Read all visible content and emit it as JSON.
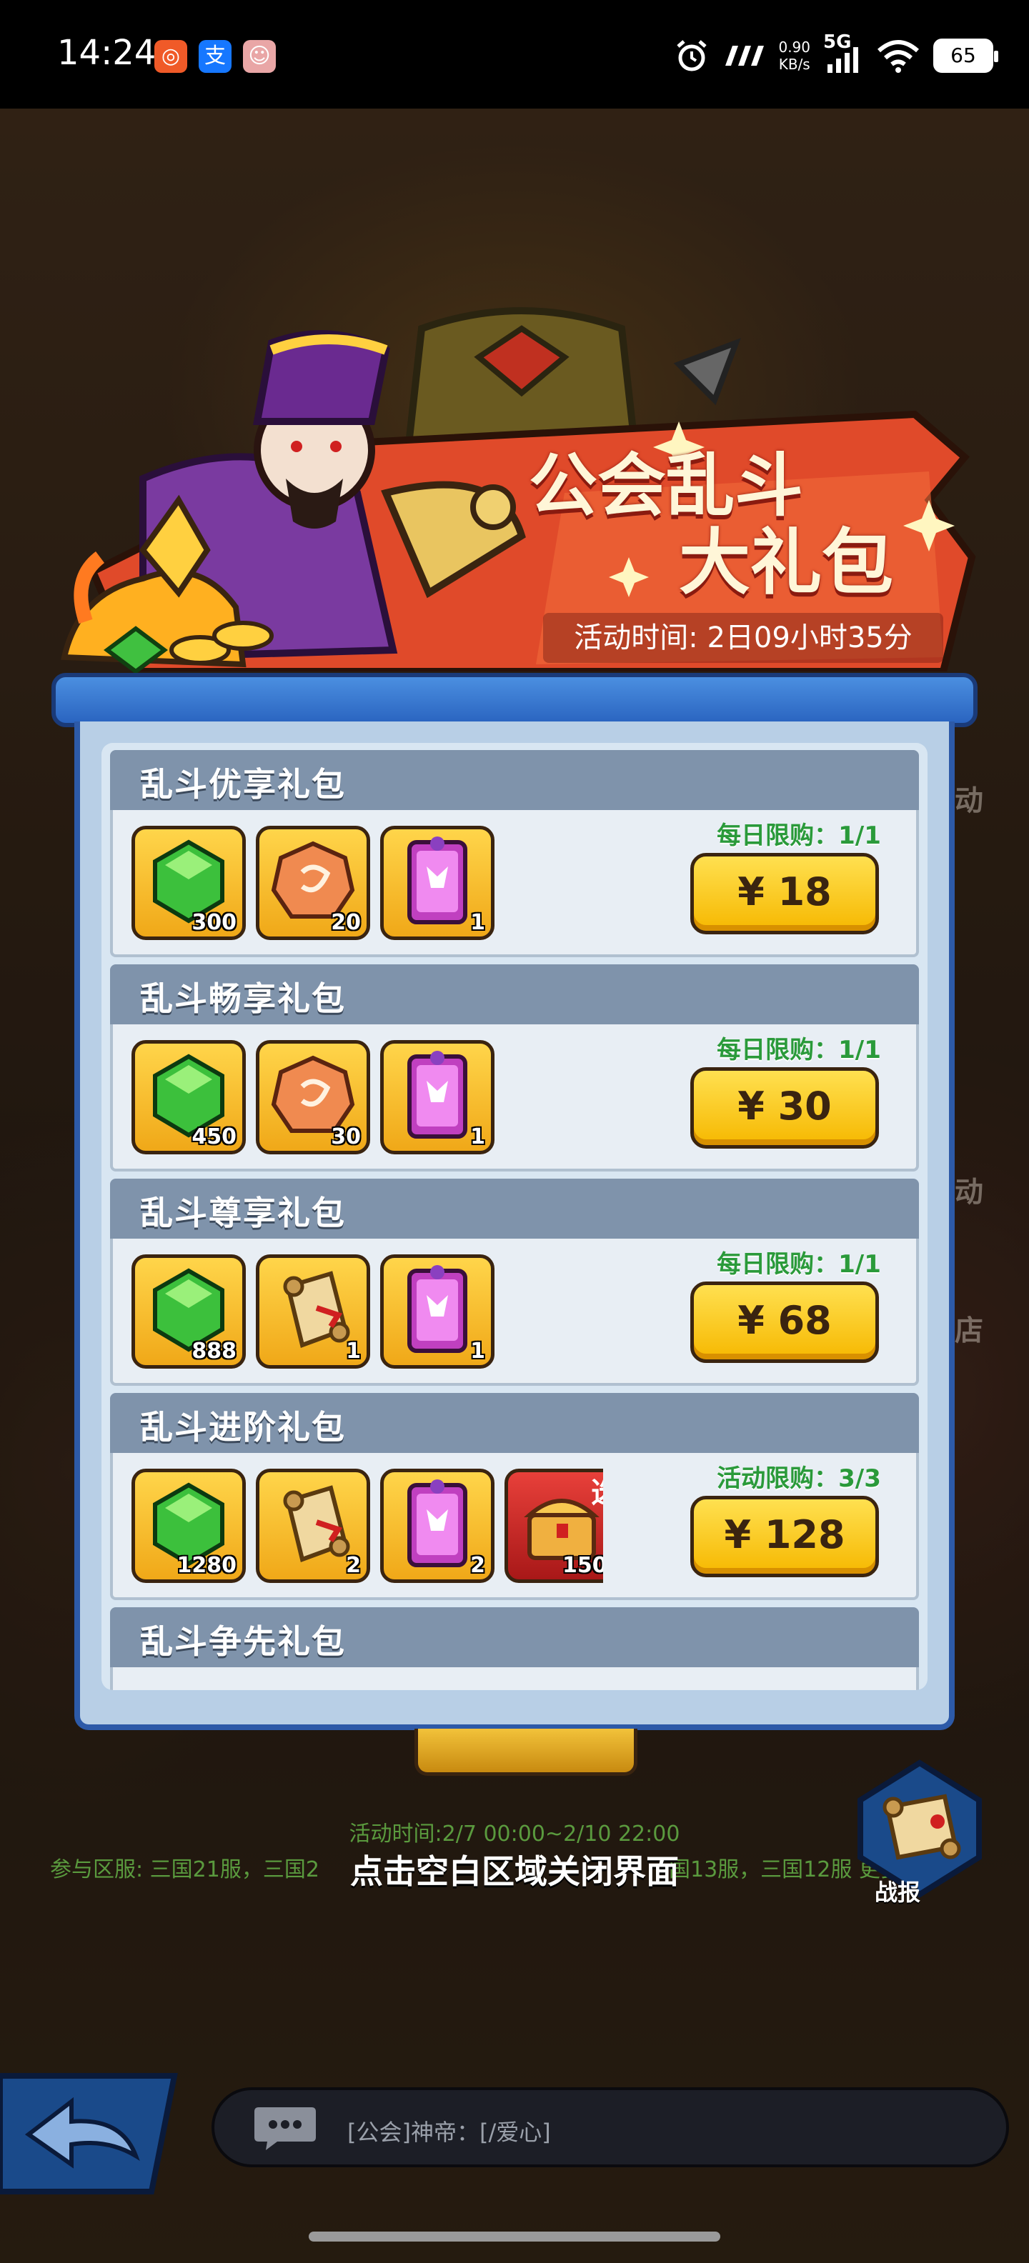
{
  "status_bar": {
    "time": "14:24",
    "network_speed_value": "0.90",
    "network_speed_unit": "KB/s",
    "network_type": "5G",
    "battery": "65",
    "icons": [
      "app-badge-icon",
      "alipay-icon",
      "game-app-icon",
      "alarm-icon",
      "carrier-icon",
      "signal-icon",
      "wifi-icon",
      "battery-icon"
    ]
  },
  "banner": {
    "title_line1": "公会乱斗",
    "title_line2": "大礼包",
    "countdown": "活动时间: 2日09小时35分"
  },
  "packs": [
    {
      "name": "乱斗优享礼包",
      "limit": "每日限购：1/1",
      "price": "¥ 18",
      "items": [
        {
          "icon": "green-gem-icon",
          "qty": "300"
        },
        {
          "icon": "orange-orb-icon",
          "qty": "20"
        },
        {
          "icon": "purple-card-icon",
          "qty": "1"
        }
      ]
    },
    {
      "name": "乱斗畅享礼包",
      "limit": "每日限购：1/1",
      "price": "¥ 30",
      "items": [
        {
          "icon": "green-gem-icon",
          "qty": "450"
        },
        {
          "icon": "orange-orb-icon",
          "qty": "30"
        },
        {
          "icon": "purple-card-icon",
          "qty": "1"
        }
      ]
    },
    {
      "name": "乱斗尊享礼包",
      "limit": "每日限购：1/1",
      "price": "¥ 68",
      "items": [
        {
          "icon": "green-gem-icon",
          "qty": "888"
        },
        {
          "icon": "scroll-icon",
          "qty": "1"
        },
        {
          "icon": "purple-card-icon",
          "qty": "1"
        }
      ]
    },
    {
      "name": "乱斗进阶礼包",
      "limit": "活动限购：3/3",
      "price": "¥ 128",
      "items": [
        {
          "icon": "green-gem-icon",
          "qty": "1280"
        },
        {
          "icon": "scroll-icon",
          "qty": "2"
        },
        {
          "icon": "purple-card-icon",
          "qty": "2"
        },
        {
          "icon": "treasure-chest-icon",
          "qty": "150",
          "tag": "选"
        }
      ]
    },
    {
      "name": "乱斗争先礼包"
    }
  ],
  "footer": {
    "event_time": "活动时间:2/7 00:00~2/10 22:00",
    "servers_left": "参与区服: 三国21服，三国2",
    "servers_right": "国13服，三国12服",
    "servers_more": "更多",
    "close_hint": "点击空白区域关闭界面",
    "report_label": "战报"
  },
  "chat": {
    "message": "[公会]神帝：[/爱心]"
  },
  "background_side_labels": [
    "动",
    "动",
    "店"
  ],
  "colors": {
    "panel_blue": "#2d5aa8",
    "pack_header": "#7f93ab",
    "price_yellow": "#f6b800",
    "limit_green": "#2a9a3a",
    "banner_red": "#d8402a"
  }
}
